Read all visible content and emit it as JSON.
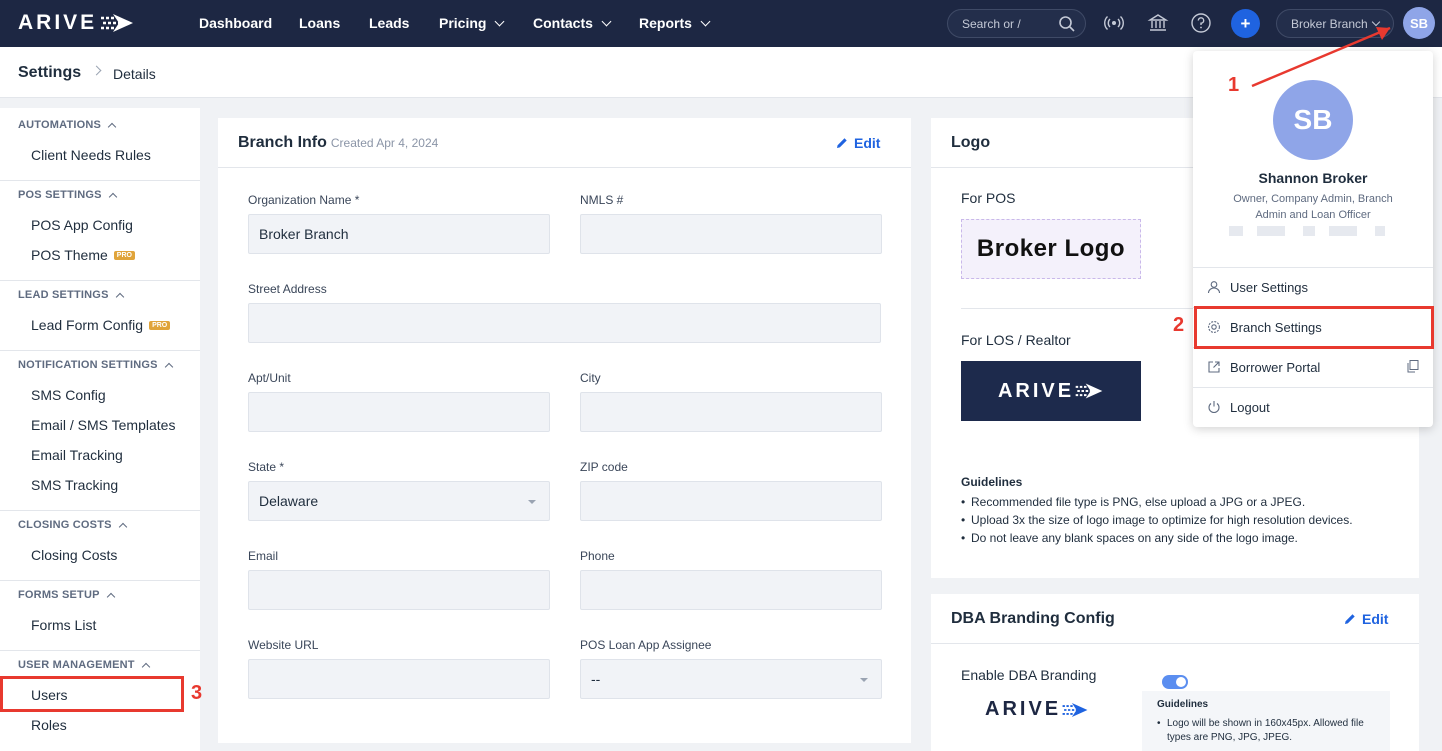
{
  "app": {
    "logo_text": "ARIVE",
    "nav": [
      "Dashboard",
      "Loans",
      "Leads",
      "Pricing",
      "Contacts",
      "Reports"
    ],
    "search_placeholder": "Search or /",
    "branch_selector": "Broker Branch",
    "avatar_initials": "SB",
    "accent_color": "#1f63e0",
    "header_color": "#1d2743"
  },
  "breadcrumb": {
    "title": "Settings",
    "current": "Details"
  },
  "sidebar": {
    "sections": [
      {
        "title": "AUTOMATIONS",
        "items": [
          {
            "label": "Client Needs Rules"
          }
        ]
      },
      {
        "title": "POS SETTINGS",
        "items": [
          {
            "label": "POS App Config"
          },
          {
            "label": "POS Theme",
            "badge": "PRO"
          }
        ]
      },
      {
        "title": "LEAD SETTINGS",
        "items": [
          {
            "label": "Lead Form Config",
            "badge": "PRO"
          }
        ]
      },
      {
        "title": "NOTIFICATION SETTINGS",
        "items": [
          {
            "label": "SMS Config"
          },
          {
            "label": "Email / SMS Templates"
          },
          {
            "label": "Email Tracking"
          },
          {
            "label": "SMS Tracking"
          }
        ]
      },
      {
        "title": "CLOSING COSTS",
        "items": [
          {
            "label": "Closing Costs"
          }
        ]
      },
      {
        "title": "FORMS SETUP",
        "items": [
          {
            "label": "Forms List"
          }
        ]
      },
      {
        "title": "USER MANAGEMENT",
        "items": [
          {
            "label": "Users"
          },
          {
            "label": "Roles"
          }
        ]
      }
    ]
  },
  "branch_info": {
    "title": "Branch Info",
    "created": "Created Apr 4, 2024",
    "edit_label": "Edit",
    "fields": {
      "org_name_label": "Organization Name *",
      "org_name_value": "Broker Branch",
      "nmls_label": "NMLS #",
      "nmls_value": "",
      "street_label": "Street Address",
      "street_value": "",
      "apt_label": "Apt/Unit",
      "apt_value": "",
      "city_label": "City",
      "city_value": "",
      "state_label": "State *",
      "state_value": "Delaware",
      "zip_label": "ZIP code",
      "zip_value": "",
      "email_label": "Email",
      "email_value": "",
      "phone_label": "Phone",
      "phone_value": "",
      "website_label": "Website URL",
      "website_value": "",
      "assignee_label": "POS Loan App Assignee",
      "assignee_value": "--"
    }
  },
  "logo_card": {
    "title": "Logo",
    "for_pos_label": "For POS",
    "pos_logo_text": "Broker Logo",
    "for_los_label": "For LOS / Realtor",
    "los_logo_text": "ARIVE",
    "guidelines_title": "Guidelines",
    "guidelines": [
      "Recommended file type is PNG, else upload a JPG or a JPEG.",
      "Upload 3x the size of logo image to optimize for high resolution devices.",
      "Do not leave any blank spaces on any side of the logo image."
    ]
  },
  "dba_card": {
    "title": "DBA Branding Config",
    "edit_label": "Edit",
    "enable_label": "Enable DBA Branding",
    "enabled": true,
    "logo_text": "ARIVE",
    "guidelines_title": "Guidelines",
    "guideline_text": "Logo will be shown in 160x45px. Allowed file types are PNG, JPG, JPEG."
  },
  "user_menu": {
    "initials": "SB",
    "name": "Shannon Broker",
    "role": "Owner, Company Admin, Branch Admin and Loan Officer",
    "items": [
      "User Settings",
      "Branch Settings",
      "Borrower Portal",
      "Logout"
    ]
  },
  "annotations": {
    "n1": "1",
    "n2": "2",
    "n3": "3",
    "color": "#e8392f"
  }
}
